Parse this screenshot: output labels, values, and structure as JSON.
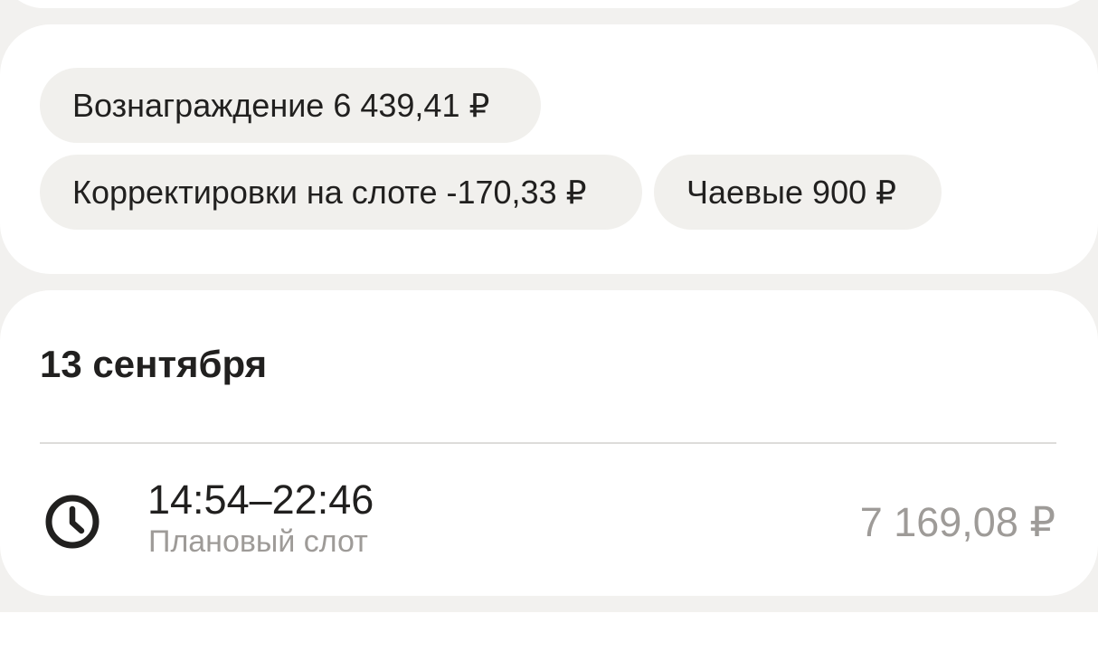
{
  "chips": {
    "reward": "Вознаграждение 6 439,41 ₽",
    "corrections": "Корректировки на слоте -170,33 ₽",
    "tips": "Чаевые 900 ₽"
  },
  "day": {
    "title": "13 сентября",
    "slot": {
      "icon": "clock-icon",
      "time": "14:54–22:46",
      "type": "Плановый слот",
      "amount": "7 169,08 ₽"
    }
  }
}
